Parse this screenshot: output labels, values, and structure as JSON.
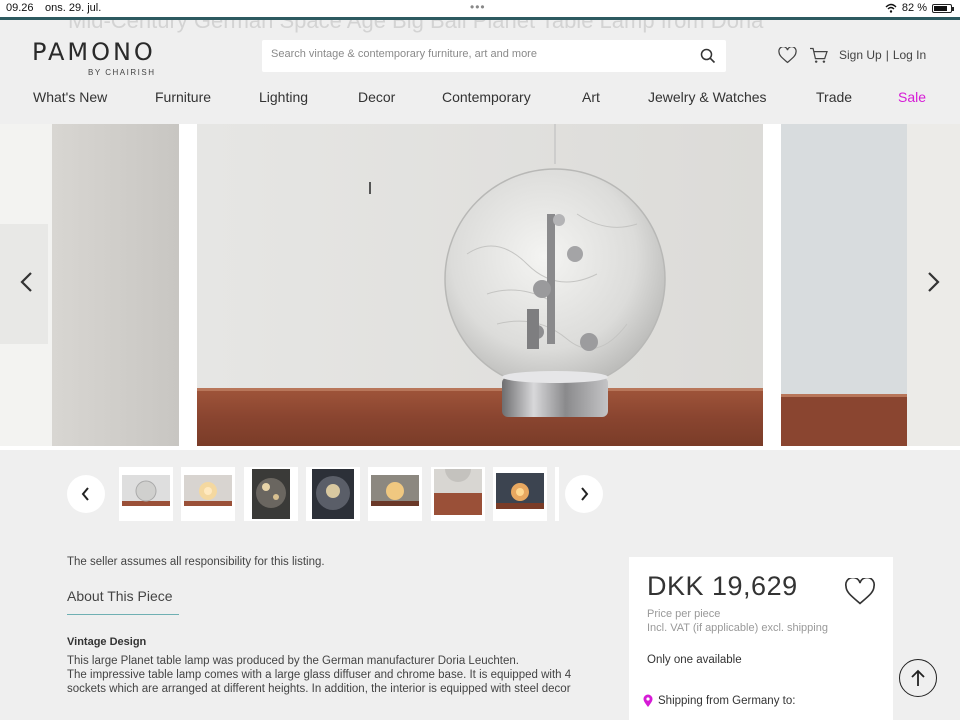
{
  "status": {
    "time": "09.26",
    "date": "ons. 29. jul.",
    "dots": "•••",
    "battery": "82 %",
    "battery_level": 0.82
  },
  "header": {
    "ghost_title": "Mid-Century German Space Age Big Ball Planet Table Lamp from Doria",
    "logo": "PAMONO",
    "logo_sub": "BY CHAIRISH",
    "search_placeholder": "Search vintage & contemporary furniture, art and more",
    "sign_up": "Sign Up",
    "separator": "|",
    "log_in": "Log In"
  },
  "nav": [
    {
      "label": "What's New"
    },
    {
      "label": "Furniture"
    },
    {
      "label": "Lighting"
    },
    {
      "label": "Decor"
    },
    {
      "label": "Contemporary"
    },
    {
      "label": "Art"
    },
    {
      "label": "Jewelry & Watches"
    },
    {
      "label": "Trade"
    },
    {
      "label": "Sale"
    }
  ],
  "colors": {
    "accent_teal": "#2d5a60",
    "sale": "#d61bd6",
    "underline": "#6fb0b3",
    "pin": "#d61bd6"
  },
  "product": {
    "notice": "The seller assumes all responsibility for this listing.",
    "about_title": "About This Piece",
    "section_title": "Vintage Design",
    "description": [
      "This large Planet table lamp was produced by the German manufacturer Doria Leuchten.",
      "The impressive table lamp comes with a large glass diffuser and chrome base. It is equipped with 4",
      "sockets which are arranged at different heights. In addition, the interior is equipped with steel decor"
    ]
  },
  "card": {
    "price": "DKK 19,629",
    "price_note": "Price per piece",
    "vat_note": "Incl. VAT (if applicable) excl. shipping",
    "availability": "Only one available",
    "shipping": "Shipping from Germany to:"
  },
  "icons": {
    "search": "search-icon",
    "heart": "heart-icon",
    "cart": "cart-icon",
    "prev": "chevron-left-icon",
    "next": "chevron-right-icon",
    "pin": "location-pin-icon",
    "up": "arrow-up-icon"
  }
}
